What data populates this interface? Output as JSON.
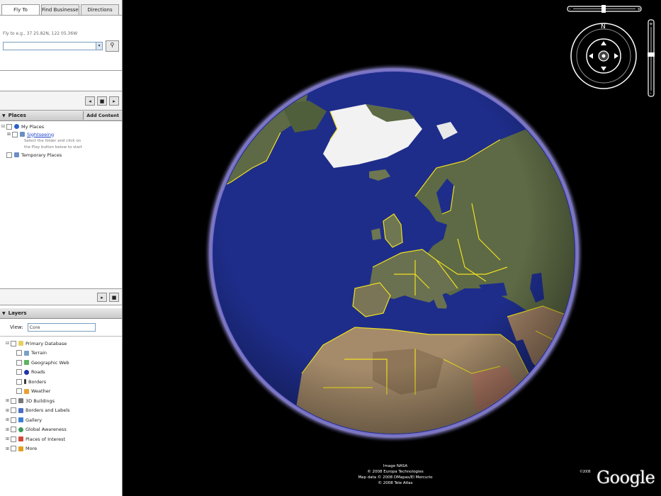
{
  "sidebar": {
    "tabs": [
      {
        "label": "Fly To"
      },
      {
        "label": "Find Businesses"
      },
      {
        "label": "Directions"
      }
    ],
    "search": {
      "hint": "Fly to e.g., 37 25.82N, 122 05.36W",
      "value": ""
    },
    "places": {
      "title": "Places",
      "add_content_label": "Add Content",
      "items": [
        {
          "label": "My Places",
          "icon_color": "#2a63c8"
        },
        {
          "label": "Sightseeing",
          "icon_color": "#6b8fc4",
          "link": true
        },
        {
          "label": "Temporary Places",
          "icon_color": "#6b8fc4"
        }
      ],
      "sightseeing_desc_1": "Select the folder and click on",
      "sightseeing_desc_2": "the Play button below to start"
    },
    "layers": {
      "title": "Layers",
      "view_label": "View:",
      "view_value": "Core",
      "items": [
        {
          "label": "Primary Database",
          "icon_color": "#e8d060"
        },
        {
          "label": "Terrain",
          "icon_color": "#7ba0c8"
        },
        {
          "label": "Geographic Web",
          "icon_color": "#5fb35f"
        },
        {
          "label": "Roads",
          "icon_color": "#2233aa"
        },
        {
          "label": "Borders",
          "icon_color": "#3a3a3a"
        },
        {
          "label": "Weather",
          "icon_color": "#e8a030"
        },
        {
          "label": "3D Buildings",
          "icon_color": "#777777"
        },
        {
          "label": "Borders and Labels",
          "icon_color": "#4a6fc4"
        },
        {
          "label": "Gallery",
          "icon_color": "#3a7fd4"
        },
        {
          "label": "Global Awareness",
          "icon_color": "#3a9a5a"
        },
        {
          "label": "Places of Interest",
          "icon_color": "#d04a3a"
        },
        {
          "label": "More",
          "icon_color": "#e0a020"
        }
      ]
    }
  },
  "viewer": {
    "credits": [
      "Image NASA",
      "© 2008 Europa Technologies",
      "Map data © 2008 DMapas/El Mercurio",
      "© 2008 Tele Atlas"
    ],
    "logo_prefix": "©2008",
    "logo": "Google"
  },
  "colors": {
    "ocean": "#1e2d8a",
    "atmosphere": "#5a4fd8",
    "land": "#5d6a45",
    "ice": "#f2f2f2",
    "desert": "#a58b6a",
    "borders": "#f0e020"
  }
}
